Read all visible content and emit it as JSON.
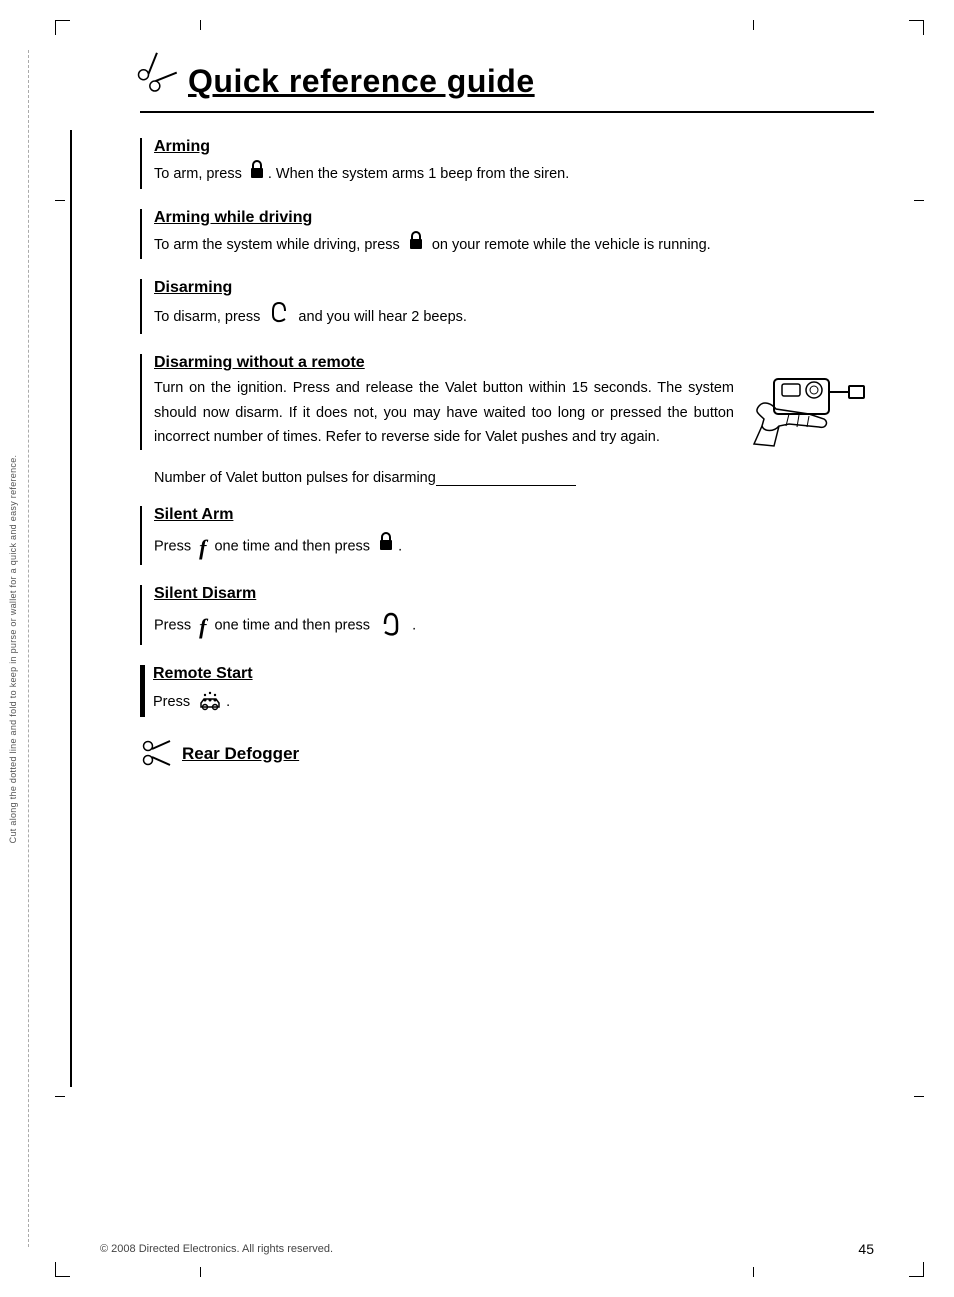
{
  "page": {
    "title": "Quick reference guide",
    "scissors_char": "✂",
    "cut_line_text": "Cut along the dotted line and fold to keep in purse or wallet for a quick and easy reference.",
    "footer": {
      "copyright": "© 2008 Directed Electronics. All rights reserved.",
      "page_number": "45"
    }
  },
  "sections": [
    {
      "id": "arming",
      "title": "Arming",
      "body": "To arm, press . When the system arms 1 beep from the siren.",
      "has_lock_before": true
    },
    {
      "id": "arming-driving",
      "title": "Arming while driving",
      "body": "To arm the system while driving, press  on your remote while the vehicle is running.",
      "has_lock_inline": true
    },
    {
      "id": "disarming",
      "title": "Disarming",
      "body": "To disarm, press  and you will hear 2 beeps.",
      "has_disarm_icon": true
    },
    {
      "id": "disarming-no-remote",
      "title": "Disarming without a remote",
      "body": "Turn on the ignition. Press and release the Valet button within 15 seconds. The system should now disarm. If it does not, you may have waited too long or pressed the button incorrect number of times. Refer to reverse side for Valet pushes and try again."
    },
    {
      "id": "valet-line",
      "text": "Number of Valet button pulses for disarming"
    },
    {
      "id": "silent-arm",
      "title": "Silent Arm",
      "body_prefix": "Press ",
      "body_suffix": " one time and then press .",
      "has_func_icon": true,
      "has_lock_end": true
    },
    {
      "id": "silent-disarm",
      "title": "Silent Disarm",
      "body_prefix": "Press ",
      "body_suffix": " one time and then press  .",
      "has_func_icon": true,
      "has_disarm_end": true
    },
    {
      "id": "remote-start",
      "title": "Remote Start",
      "body": "Press .",
      "has_remote_icon": true
    },
    {
      "id": "rear-defogger",
      "title": "Rear Defogger",
      "has_scissors": true
    }
  ]
}
